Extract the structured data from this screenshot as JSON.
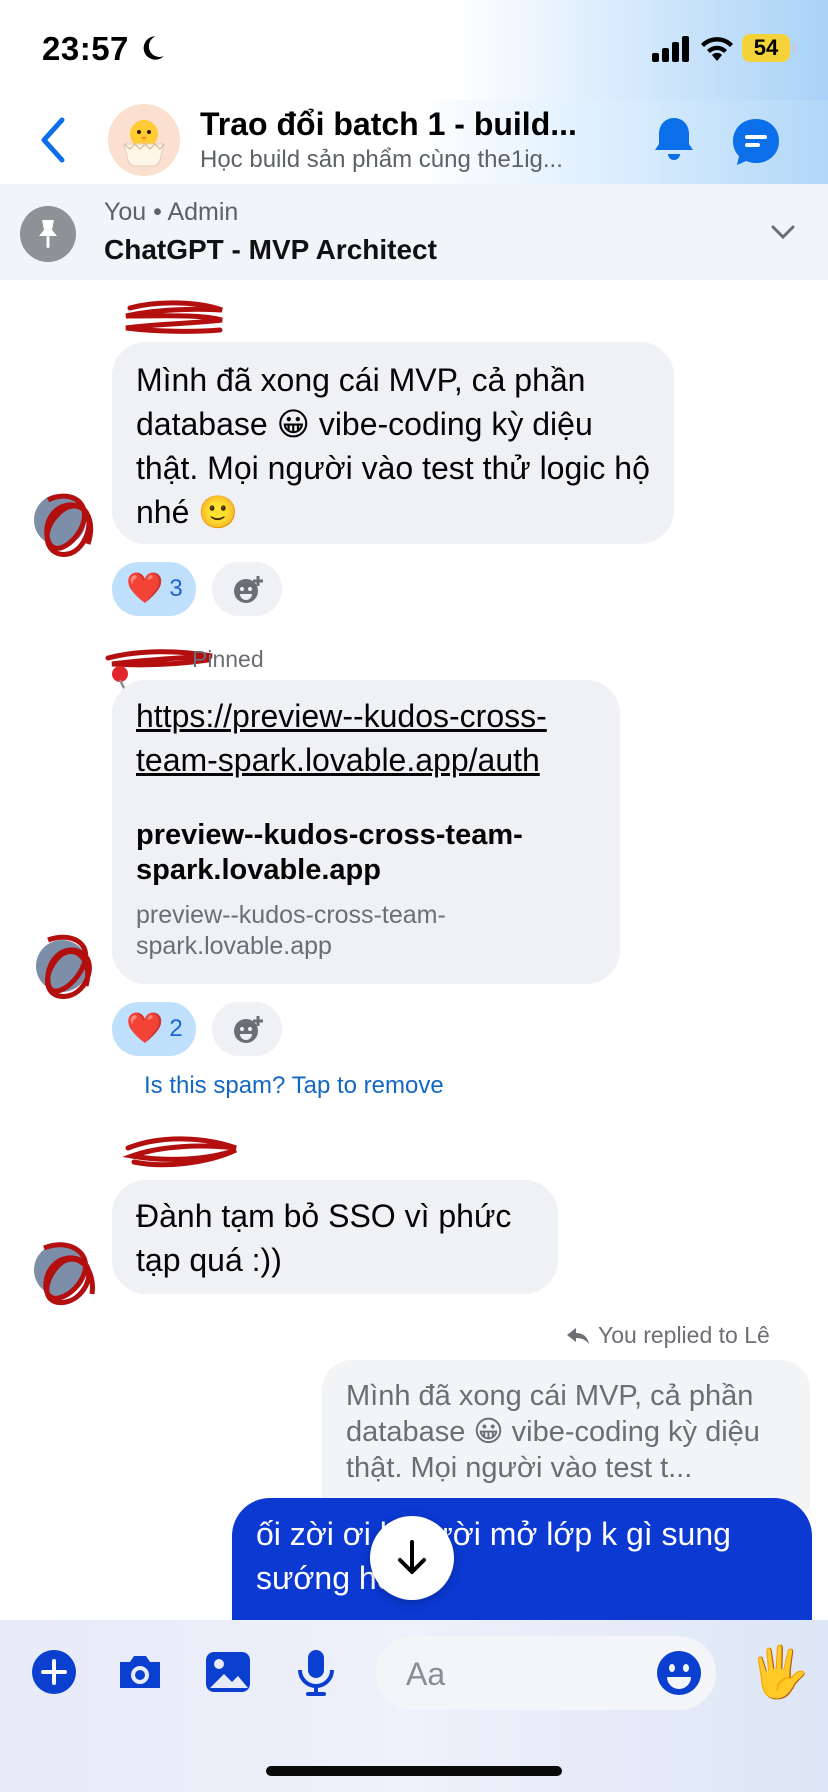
{
  "status_bar": {
    "time": "23:57",
    "battery": "54"
  },
  "header": {
    "title": "Trao đổi batch 1 - build...",
    "subtitle": "Học build sản phẩm cùng the1ig..."
  },
  "pinned": {
    "meta": "You • Admin",
    "title": "ChatGPT - MVP Architect"
  },
  "messages": {
    "m1": {
      "text": "Mình đã xong cái MVP, cả phần database 😀 vibe-coding kỳ diệu thật. Mọi người vào test thử logic hộ nhé 🙂",
      "reaction": "❤️",
      "reaction_count": "3"
    },
    "m2": {
      "pinned_label": "Pinned",
      "url": "https://preview--kudos-cross-team-spark.lovable.app/auth",
      "preview_title": "preview--kudos-cross-team-spark.lovable.app",
      "preview_domain": "preview--kudos-cross-team-spark.lovable.app",
      "reaction": "❤️",
      "reaction_count": "2",
      "spam_note": "Is this spam? Tap to remove"
    },
    "m3": {
      "text": "Đành tạm bỏ SSO vì phức tạp quá :))"
    },
    "m4": {
      "reply_note": "You replied to Lê",
      "quoted": "Mình đã xong cái MVP, cả phần database 😀 vibe-coding kỳ diệu thật. Mọi người vào test t...",
      "text": "ối zời ơi l     người mở lớp k gì sung sướng hơ"
    }
  },
  "composer": {
    "placeholder": "Aa",
    "wave": "🖐️"
  },
  "colors": {
    "accent": "#0a6fe8",
    "outgoing": "#0b39d2",
    "reaction_bg": "#bfe0fc",
    "scribble": "#b30f0f"
  }
}
